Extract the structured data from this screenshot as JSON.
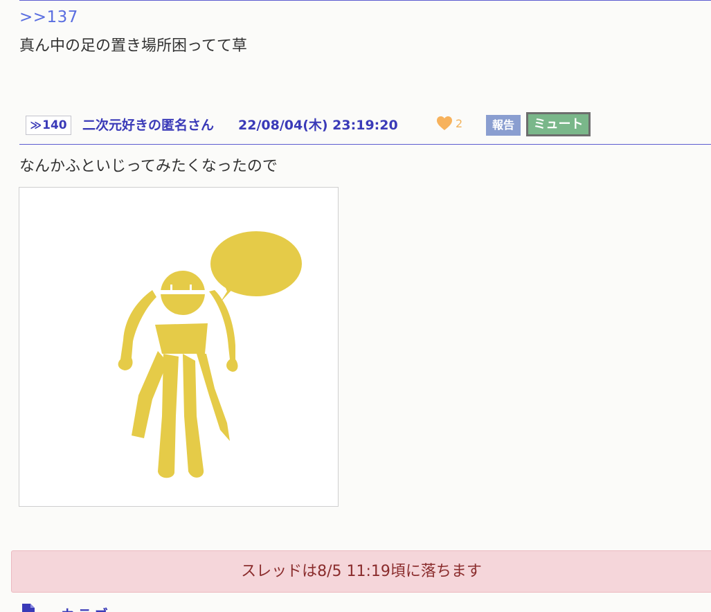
{
  "previous_post": {
    "anchor": ">>137",
    "text": "真ん中の足の置き場所困ってて草"
  },
  "post": {
    "number_arrow": "≫",
    "number": "140",
    "name": "二次元好きの匿名さん",
    "date": "22/08/04(木) 23:19:20",
    "like_count": "2",
    "report_label": "報告",
    "mute_label": "ミュート",
    "body": "なんかふといじってみたくなったので",
    "image_icon": "yellow-stick-figure-with-speech-bubble"
  },
  "notice": {
    "text": "スレッドは8/5 11:19頃に落ちます"
  },
  "footer": {
    "icon": "document-icon",
    "label": "カテゴ"
  },
  "colors": {
    "link": "#5a6ee0",
    "name": "#3a3ab8",
    "heart": "#f7b25c",
    "report_bg": "#8a9ed0",
    "mute_bg": "#7ab78a",
    "notice_bg": "#f5d6da",
    "notice_text": "#8a2c2c",
    "figure": "#e5cb48"
  }
}
